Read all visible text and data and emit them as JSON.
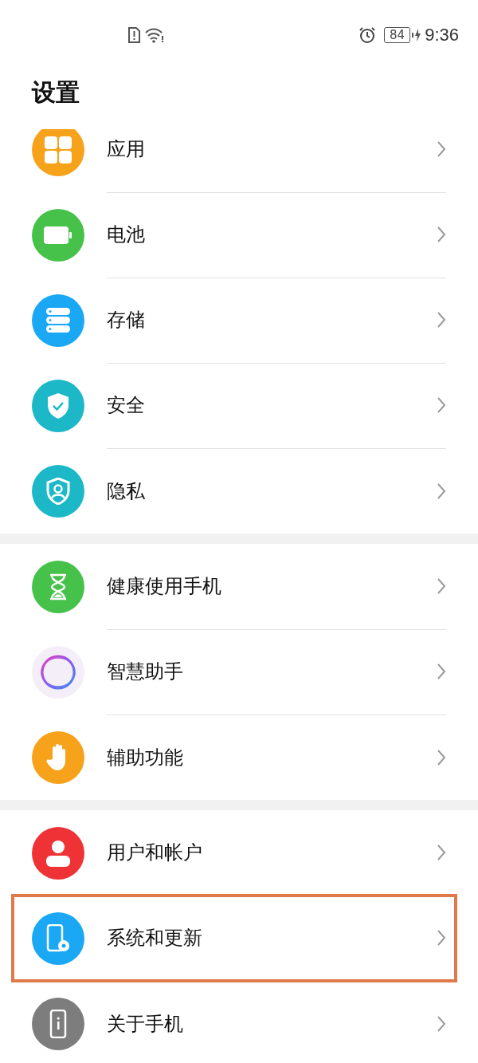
{
  "status_bar": {
    "battery": "84",
    "time": "9:36"
  },
  "title": "设置",
  "sections": [
    {
      "items": [
        {
          "label": "应用",
          "kind": "apps",
          "color": "#f7a21b",
          "highlighted": false
        },
        {
          "label": "电池",
          "kind": "battery",
          "color": "#46c24a",
          "highlighted": false
        },
        {
          "label": "存储",
          "kind": "storage",
          "color": "#1aa8f5",
          "highlighted": false
        },
        {
          "label": "安全",
          "kind": "shield",
          "color": "#1cb8c8",
          "highlighted": false
        },
        {
          "label": "隐私",
          "kind": "privacy",
          "color": "#1cb8c8",
          "highlighted": false
        }
      ]
    },
    {
      "items": [
        {
          "label": "健康使用手机",
          "kind": "hourglass",
          "color": "#46c24a",
          "highlighted": false
        },
        {
          "label": "智慧助手",
          "kind": "ring",
          "color": "#f3eef8",
          "highlighted": false
        },
        {
          "label": "辅助功能",
          "kind": "hand",
          "color": "#f7a21b",
          "highlighted": false
        }
      ]
    },
    {
      "items": [
        {
          "label": "用户和帐户",
          "kind": "user",
          "color": "#ee3236",
          "highlighted": false
        },
        {
          "label": "系统和更新",
          "kind": "phone-gear",
          "color": "#1aa8f5",
          "highlighted": true
        },
        {
          "label": "关于手机",
          "kind": "phone-info",
          "color": "#7d7d7d",
          "highlighted": false
        }
      ]
    }
  ]
}
